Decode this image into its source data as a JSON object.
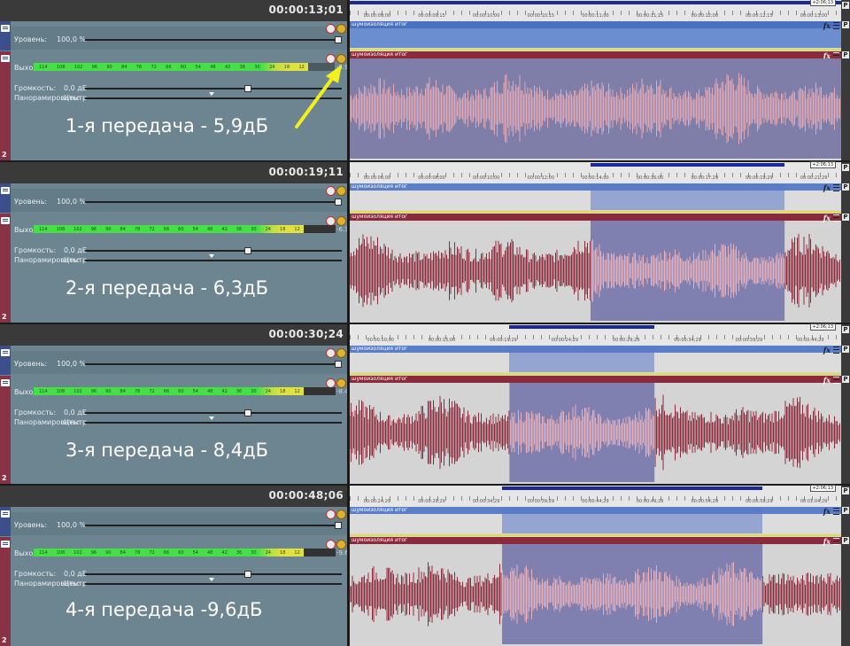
{
  "track_labels": {
    "level": "Уровень:",
    "level_value": "100,0 %",
    "output": "Выход",
    "volume": "Громкость:",
    "volume_value": "0,0 дБ",
    "pan": "Панорамировать:",
    "pan_value": "Центр"
  },
  "meter_scale": [
    "114",
    "108",
    "102",
    "96",
    "90",
    "84",
    "78",
    "72",
    "66",
    "60",
    "54",
    "48",
    "42",
    "36",
    "30",
    "24",
    "18",
    "12"
  ],
  "event_name": "шумоизоляция итог",
  "panels": [
    {
      "time": "00:00:13;01",
      "caption": "1-я передача - 5,9дБ",
      "meter_value": "-5.9",
      "track_num": "2",
      "ruler": [
        "00:00:09;00",
        "00:00:09;15",
        "00:00:10;00",
        "00:00:10;15",
        "00:00:11;00",
        "00:00:11;15",
        "00:00:12;00",
        "00:00:12;15",
        "00:00:13;00"
      ],
      "sel_start": 0.0,
      "sel_end": 1.0,
      "wave_color": "#d9a0ab",
      "marker": "+2:06;13"
    },
    {
      "time": "00:00:19;11",
      "caption": "2-я передача - 6,3дБ",
      "meter_value": "-6.3",
      "track_num": "2",
      "ruler": [
        "00:00:06;00",
        "00:00:08;00",
        "00:00:10;00",
        "00:00:12;00",
        "00:00:14;00",
        "00:00:16;00",
        "00:00:17;29",
        "00:00:19;29",
        "00:00:21;29"
      ],
      "sel_start": 0.49,
      "sel_end": 0.885,
      "wave_color": "#8b2a3a",
      "marker": "+2:06;13"
    },
    {
      "time": "00:00:30;24",
      "caption": "3-я передача - 8,4дБ",
      "meter_value": "-8.4",
      "track_num": "2",
      "ruler": [
        "00:00:10;00",
        "00:00:15;00",
        "00:00:19;29",
        "00:00:24;29",
        "00:00:29;29",
        "00:00:34;29",
        "00:00:39;29",
        "00:00:44;29"
      ],
      "sel_start": 0.325,
      "sel_end": 0.62,
      "wave_color": "#8b2a3a",
      "marker": "+2:06;13"
    },
    {
      "time": "00:00:48;06",
      "caption": "4-я передача  -9,6дБ",
      "meter_value": "-9.6",
      "track_num": "2",
      "ruler": [
        "00:00:24;29",
        "00:00:29;29",
        "00:00:34;29",
        "00:00:39;29",
        "00:00:44;29",
        "00:00:49;29",
        "00:00:54;29",
        "00:00:59;29",
        "00:01:04;29"
      ],
      "sel_start": 0.31,
      "sel_end": 0.84,
      "wave_color": "#8b2a3a",
      "marker": "+2:06;13"
    }
  ],
  "fx_label": "fx",
  "p_label": "P"
}
